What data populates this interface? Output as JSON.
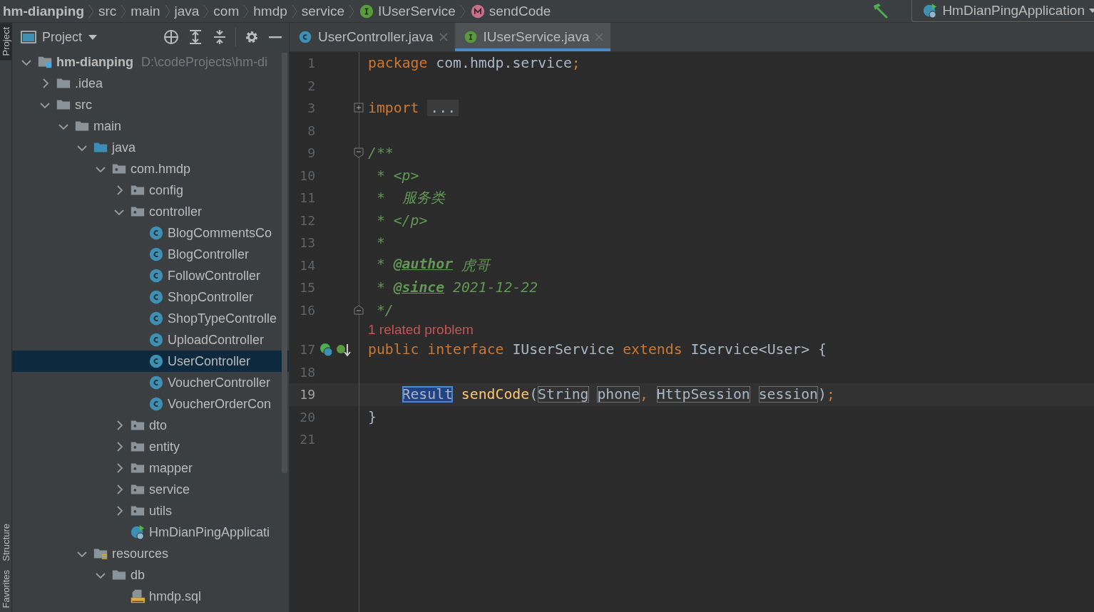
{
  "breadcrumbs": [
    {
      "label": "hm-dianping",
      "kind": "project"
    },
    {
      "label": "src",
      "kind": "folder"
    },
    {
      "label": "main",
      "kind": "folder"
    },
    {
      "label": "java",
      "kind": "folder"
    },
    {
      "label": "com",
      "kind": "folder"
    },
    {
      "label": "hmdp",
      "kind": "folder"
    },
    {
      "label": "service",
      "kind": "folder"
    },
    {
      "label": "IUserService",
      "kind": "interface"
    },
    {
      "label": "sendCode",
      "kind": "method"
    }
  ],
  "run_config": {
    "label": "HmDianPingApplication"
  },
  "tool_stripe": [
    {
      "label": "Project",
      "selected": true
    },
    {
      "label": "Structure",
      "selected": false
    },
    {
      "label": "Favorites",
      "selected": false
    }
  ],
  "project_panel": {
    "title": "Project",
    "tree": [
      {
        "label": "hm-dianping",
        "path": "D:\\codeProjects\\hm-di",
        "kind": "module",
        "expanded": true,
        "selected": false,
        "children": [
          {
            "label": ".idea",
            "kind": "folder",
            "expanded": false,
            "selected": false
          },
          {
            "label": "src",
            "kind": "folder",
            "expanded": true,
            "selected": false,
            "children": [
              {
                "label": "main",
                "kind": "folder",
                "expanded": true,
                "selected": false,
                "children": [
                  {
                    "label": "java",
                    "kind": "source-folder",
                    "expanded": true,
                    "selected": false,
                    "children": [
                      {
                        "label": "com.hmdp",
                        "kind": "package",
                        "expanded": true,
                        "selected": false,
                        "children": [
                          {
                            "label": "config",
                            "kind": "package",
                            "expanded": false,
                            "selected": false
                          },
                          {
                            "label": "controller",
                            "kind": "package",
                            "expanded": true,
                            "selected": false,
                            "children": [
                              {
                                "label": "BlogCommentsCo",
                                "kind": "class",
                                "selected": false
                              },
                              {
                                "label": "BlogController",
                                "kind": "class",
                                "selected": false
                              },
                              {
                                "label": "FollowController",
                                "kind": "class",
                                "selected": false
                              },
                              {
                                "label": "ShopController",
                                "kind": "class",
                                "selected": false
                              },
                              {
                                "label": "ShopTypeControlle",
                                "kind": "class",
                                "selected": false
                              },
                              {
                                "label": "UploadController",
                                "kind": "class",
                                "selected": false
                              },
                              {
                                "label": "UserController",
                                "kind": "class",
                                "selected": true
                              },
                              {
                                "label": "VoucherController",
                                "kind": "class",
                                "selected": false
                              },
                              {
                                "label": "VoucherOrderCon",
                                "kind": "class",
                                "selected": false
                              }
                            ]
                          },
                          {
                            "label": "dto",
                            "kind": "package",
                            "expanded": false,
                            "selected": false
                          },
                          {
                            "label": "entity",
                            "kind": "package",
                            "expanded": false,
                            "selected": false
                          },
                          {
                            "label": "mapper",
                            "kind": "package",
                            "expanded": false,
                            "selected": false
                          },
                          {
                            "label": "service",
                            "kind": "package",
                            "expanded": false,
                            "selected": false
                          },
                          {
                            "label": "utils",
                            "kind": "package",
                            "expanded": false,
                            "selected": false
                          },
                          {
                            "label": "HmDianPingApplicati",
                            "kind": "app",
                            "selected": false
                          }
                        ]
                      }
                    ]
                  },
                  {
                    "label": "resources",
                    "kind": "resources-folder",
                    "expanded": true,
                    "selected": false,
                    "children": [
                      {
                        "label": "db",
                        "kind": "folder",
                        "expanded": true,
                        "selected": false,
                        "children": [
                          {
                            "label": "hmdp.sql",
                            "kind": "sql",
                            "selected": false
                          }
                        ]
                      }
                    ]
                  }
                ]
              }
            ]
          }
        ]
      }
    ]
  },
  "editor": {
    "tabs": [
      {
        "label": "UserController.java",
        "kind": "class",
        "selected": false
      },
      {
        "label": "IUserService.java",
        "kind": "interface",
        "selected": true
      }
    ],
    "lines": [
      {
        "number": "1",
        "tokens": [
          {
            "text": "package",
            "kind": "keyword"
          },
          {
            "text": "com.hmdp.service",
            "kind": "plain",
            "space_before": true
          },
          {
            "text": ";",
            "kind": "keyword"
          }
        ]
      },
      {
        "number": "2"
      },
      {
        "number": "3",
        "folded": true,
        "tokens": [
          {
            "text": "import",
            "kind": "keyword"
          },
          {
            "text": "...",
            "kind": "folded",
            "space_before": true
          }
        ]
      },
      {
        "number": "8"
      },
      {
        "number": "9",
        "fold_start": true,
        "tokens": [
          {
            "text": "/**",
            "kind": "comment"
          }
        ]
      },
      {
        "number": "10",
        "tokens": [
          {
            "text": "* <p>",
            "kind": "comment",
            "space_before": true
          }
        ]
      },
      {
        "number": "11",
        "tokens": [
          {
            "text": "*  服务类",
            "kind": "comment",
            "space_before": true
          }
        ]
      },
      {
        "number": "12",
        "tokens": [
          {
            "text": "* </p>",
            "kind": "comment",
            "space_before": true
          }
        ]
      },
      {
        "number": "13",
        "tokens": [
          {
            "text": "*",
            "kind": "comment",
            "space_before": true
          }
        ]
      },
      {
        "number": "14",
        "tokens": [
          {
            "text": "*",
            "kind": "comment",
            "space_before": true
          },
          {
            "text": "@author",
            "kind": "tag",
            "space_before": true
          },
          {
            "text": "虎哥",
            "kind": "comment",
            "space_before": true
          }
        ]
      },
      {
        "number": "15",
        "tokens": [
          {
            "text": "*",
            "kind": "comment",
            "space_before": true
          },
          {
            "text": "@since",
            "kind": "tag",
            "space_before": true
          },
          {
            "text": "2021-12-22",
            "kind": "comment",
            "space_before": true
          }
        ]
      },
      {
        "number": "16",
        "fold_end": true,
        "tokens": [
          {
            "text": "*/",
            "kind": "comment",
            "space_before": true
          }
        ]
      },
      {
        "inlay": "1 related problem"
      },
      {
        "number": "17",
        "markers": true,
        "tokens": [
          {
            "text": "public",
            "kind": "keyword"
          },
          {
            "text": "interface",
            "kind": "keyword",
            "space_before": true
          },
          {
            "text": "IUserService",
            "kind": "plain",
            "space_before": true
          },
          {
            "text": "extends",
            "kind": "keyword",
            "space_before": true
          },
          {
            "text": "IService<User> {",
            "kind": "plain",
            "space_before": true
          }
        ]
      },
      {
        "number": "18"
      },
      {
        "number": "19",
        "current": true,
        "indented": true,
        "tokens": [
          {
            "text": "Result",
            "kind": "selected"
          },
          {
            "text": "sendCode",
            "kind": "method",
            "space_before": true
          },
          {
            "text": "(",
            "kind": "plain"
          },
          {
            "text": "String",
            "kind": "boxed"
          },
          {
            "text": "phone",
            "kind": "boxed",
            "space_before": true
          },
          {
            "text": ",",
            "kind": "keyword"
          },
          {
            "text": "HttpSession",
            "kind": "boxed",
            "space_before": true
          },
          {
            "text": "session",
            "kind": "boxed",
            "space_before": true
          },
          {
            "text": ")",
            "kind": "plain"
          },
          {
            "text": ";",
            "kind": "keyword"
          }
        ]
      },
      {
        "number": "20",
        "tokens": [
          {
            "text": "}",
            "kind": "plain"
          }
        ]
      },
      {
        "number": "21"
      }
    ]
  }
}
